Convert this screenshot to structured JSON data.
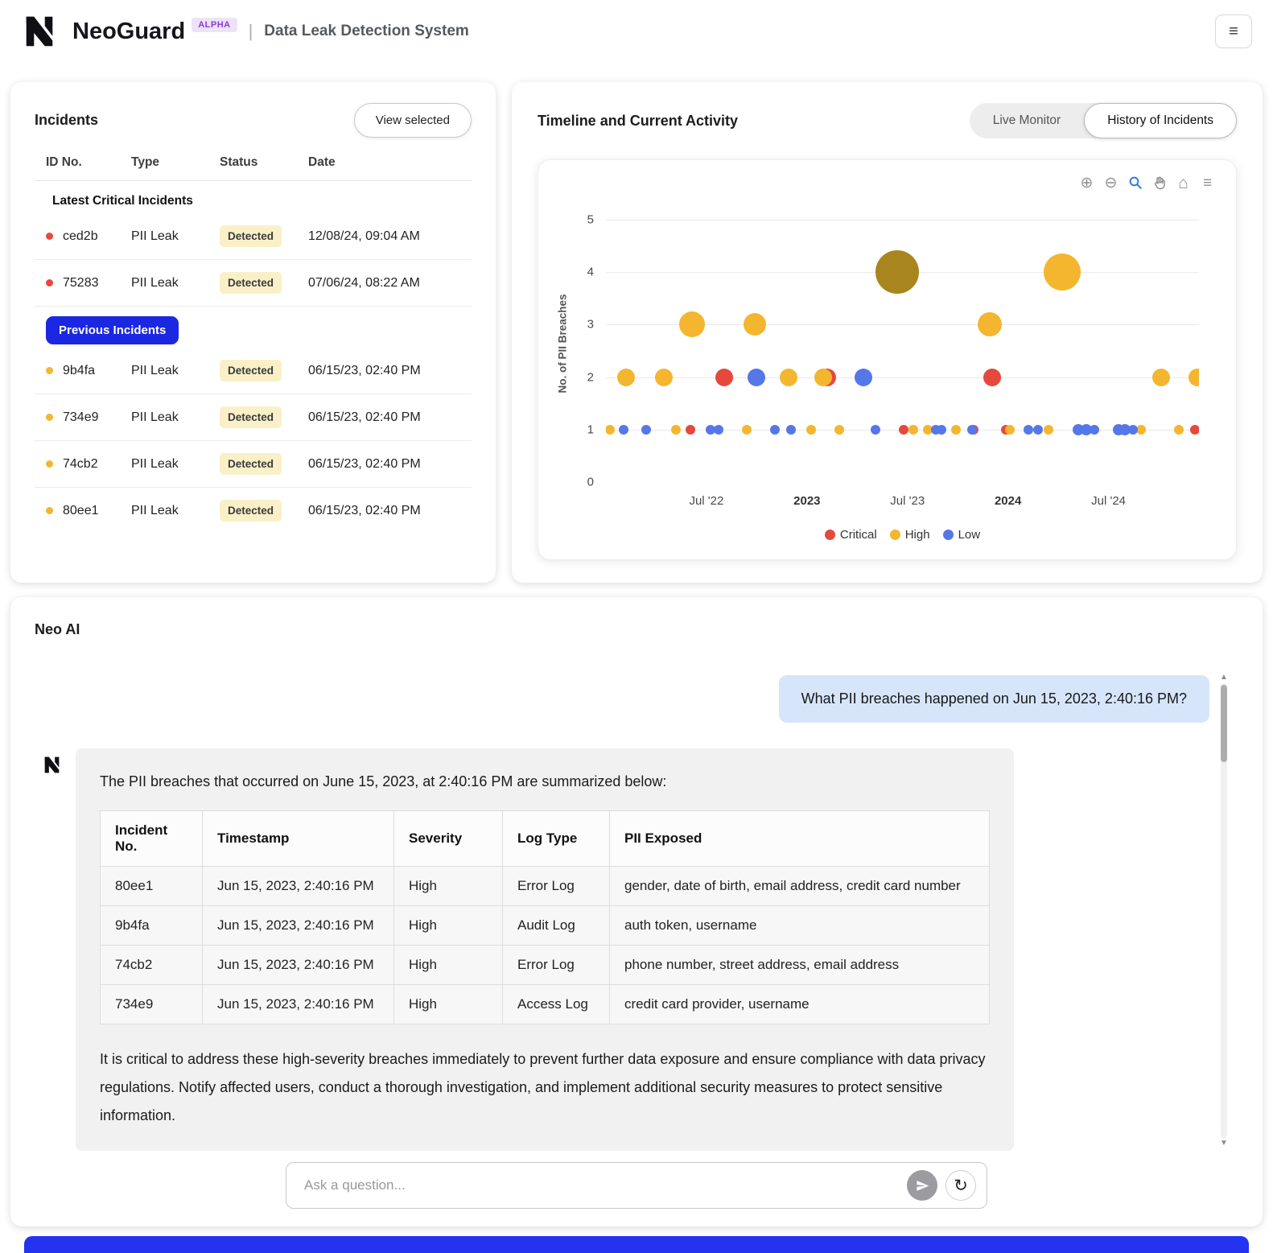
{
  "colors": {
    "critical": "#E5493C",
    "high": "#F4B62F",
    "low": "#5577E8",
    "selected": "#A8861D",
    "accent_blue": "#1B27E1",
    "footer_blue": "#2433F0",
    "status_badge_bg": "#FAF0C8",
    "user_bubble_bg": "#D7E5FA",
    "assistant_bubble_bg": "#F1F1F2"
  },
  "icons": {
    "menu": "≡",
    "zoom_in": "⊕",
    "zoom_out": "⊖",
    "home": "⌂",
    "modebar_menu": "≡",
    "refresh": "↻",
    "scroll_up": "▲",
    "scroll_down": "▼"
  },
  "header": {
    "app_name": "NeoGuard",
    "badge": "ALPHA",
    "separator": "|",
    "subtitle": "Data Leak Detection System"
  },
  "incidents": {
    "title": "Incidents",
    "view_selected_label": "View selected",
    "columns": [
      "ID No.",
      "Type",
      "Status",
      "Date"
    ],
    "sections": [
      {
        "label": "Latest Critical Incidents",
        "style": "plain",
        "rows": [
          {
            "id": "ced2b",
            "type": "PII Leak",
            "status": "Detected",
            "date": "12/08/24, 09:04 AM",
            "severity": "critical"
          },
          {
            "id": "75283",
            "type": "PII Leak",
            "status": "Detected",
            "date": "07/06/24, 08:22 AM",
            "severity": "critical"
          }
        ]
      },
      {
        "label": "Previous Incidents",
        "style": "badge",
        "rows": [
          {
            "id": "9b4fa",
            "type": "PII Leak",
            "status": "Detected",
            "date": "06/15/23, 02:40 PM",
            "severity": "high"
          },
          {
            "id": "734e9",
            "type": "PII Leak",
            "status": "Detected",
            "date": "06/15/23, 02:40 PM",
            "severity": "high"
          },
          {
            "id": "74cb2",
            "type": "PII Leak",
            "status": "Detected",
            "date": "06/15/23, 02:40 PM",
            "severity": "high"
          },
          {
            "id": "80ee1",
            "type": "PII Leak",
            "status": "Detected",
            "date": "06/15/23, 02:40 PM",
            "severity": "high"
          }
        ]
      }
    ]
  },
  "timeline": {
    "title": "Timeline and Current Activity",
    "tabs": [
      {
        "label": "Live Monitor",
        "active": false
      },
      {
        "label": "History of Incidents",
        "active": true
      }
    ]
  },
  "chart_data": {
    "type": "scatter",
    "title": "Timeline and Current Activity",
    "xlabel": "",
    "ylabel": "No. of PII Breaches",
    "xlim": [
      2022.0,
      2024.95
    ],
    "ylim": [
      0,
      5
    ],
    "grid": true,
    "legend_position": "bottom",
    "x_ticks": [
      {
        "value": 2022.5,
        "label": "Jul '22",
        "bold": false
      },
      {
        "value": 2023.0,
        "label": "2023",
        "bold": true
      },
      {
        "value": 2023.5,
        "label": "Jul '23",
        "bold": false
      },
      {
        "value": 2024.0,
        "label": "2024",
        "bold": true
      },
      {
        "value": 2024.5,
        "label": "Jul '24",
        "bold": false
      }
    ],
    "y_ticks": [
      0,
      1,
      2,
      3,
      4,
      5
    ],
    "point_format": [
      "x_year_fraction",
      "num_pii_breaches",
      "radius_px"
    ],
    "series": [
      {
        "name": "Critical",
        "color": "#E5493C",
        "points": [
          [
            2022.42,
            1,
            6
          ],
          [
            2022.59,
            2,
            11
          ],
          [
            2023.1,
            2,
            11
          ],
          [
            2023.48,
            1,
            6
          ],
          [
            2023.83,
            1,
            6
          ],
          [
            2023.92,
            2,
            11
          ],
          [
            2023.99,
            1,
            6
          ],
          [
            2024.93,
            1,
            6
          ]
        ]
      },
      {
        "name": "High",
        "color": "#F4B62F",
        "points": [
          [
            2022.02,
            1,
            6
          ],
          [
            2022.1,
            2,
            11
          ],
          [
            2022.29,
            2,
            11
          ],
          [
            2022.35,
            1,
            6
          ],
          [
            2022.43,
            3,
            16
          ],
          [
            2022.7,
            1,
            6
          ],
          [
            2022.74,
            3,
            14
          ],
          [
            2022.91,
            2,
            11
          ],
          [
            2023.02,
            1,
            6
          ],
          [
            2023.08,
            2,
            11
          ],
          [
            2023.16,
            1,
            6
          ],
          [
            2023.53,
            1,
            6
          ],
          [
            2023.6,
            1,
            6
          ],
          [
            2023.74,
            1,
            6
          ],
          [
            2023.91,
            3,
            15
          ],
          [
            2024.01,
            1,
            6
          ],
          [
            2024.2,
            1,
            6
          ],
          [
            2024.27,
            4,
            23
          ],
          [
            2024.66,
            1,
            6
          ],
          [
            2024.76,
            2,
            11
          ],
          [
            2024.85,
            1,
            6
          ],
          [
            2024.94,
            2,
            11
          ]
        ]
      },
      {
        "name": "Low",
        "color": "#5577E8",
        "points": [
          [
            2022.09,
            1,
            6
          ],
          [
            2022.2,
            1,
            6
          ],
          [
            2022.52,
            1,
            6
          ],
          [
            2022.56,
            1,
            6
          ],
          [
            2022.75,
            2,
            11
          ],
          [
            2022.84,
            1,
            6
          ],
          [
            2022.92,
            1,
            6
          ],
          [
            2023.28,
            2,
            11
          ],
          [
            2023.34,
            1,
            6
          ],
          [
            2023.64,
            1,
            6
          ],
          [
            2023.67,
            1,
            6
          ],
          [
            2023.82,
            1,
            6
          ],
          [
            2024.1,
            1,
            6
          ],
          [
            2024.15,
            1,
            6
          ],
          [
            2024.35,
            1,
            7
          ],
          [
            2024.39,
            1,
            7
          ],
          [
            2024.43,
            1,
            6
          ],
          [
            2024.55,
            1,
            7
          ],
          [
            2024.58,
            1,
            7
          ],
          [
            2024.62,
            1,
            6
          ]
        ]
      }
    ],
    "selected_point": {
      "series": "High",
      "x": 2023.45,
      "y": 4,
      "r": 27,
      "color": "#A8861D"
    }
  },
  "neo_ai": {
    "title": "Neo AI",
    "user_message": "What PII breaches happened on Jun 15, 2023, 2:40:16 PM?",
    "assistant": {
      "intro": "The PII breaches that occurred on June 15, 2023, at 2:40:16 PM are summarized below:",
      "table": {
        "columns": [
          "Incident No.",
          "Timestamp",
          "Severity",
          "Log Type",
          "PII Exposed"
        ],
        "rows": [
          [
            "80ee1",
            "Jun 15, 2023, 2:40:16 PM",
            "High",
            "Error Log",
            "gender, date of birth, email address, credit card number"
          ],
          [
            "9b4fa",
            "Jun 15, 2023, 2:40:16 PM",
            "High",
            "Audit Log",
            "auth token, username"
          ],
          [
            "74cb2",
            "Jun 15, 2023, 2:40:16 PM",
            "High",
            "Error Log",
            "phone number, street address, email address"
          ],
          [
            "734e9",
            "Jun 15, 2023, 2:40:16 PM",
            "High",
            "Access Log",
            "credit card provider, username"
          ]
        ]
      },
      "outro": "It is critical to address these high-severity breaches immediately to prevent further data exposure and ensure compliance with data privacy regulations. Notify affected users, conduct a thorough investigation, and implement additional security measures to protect sensitive information."
    },
    "input_placeholder": "Ask a question..."
  }
}
